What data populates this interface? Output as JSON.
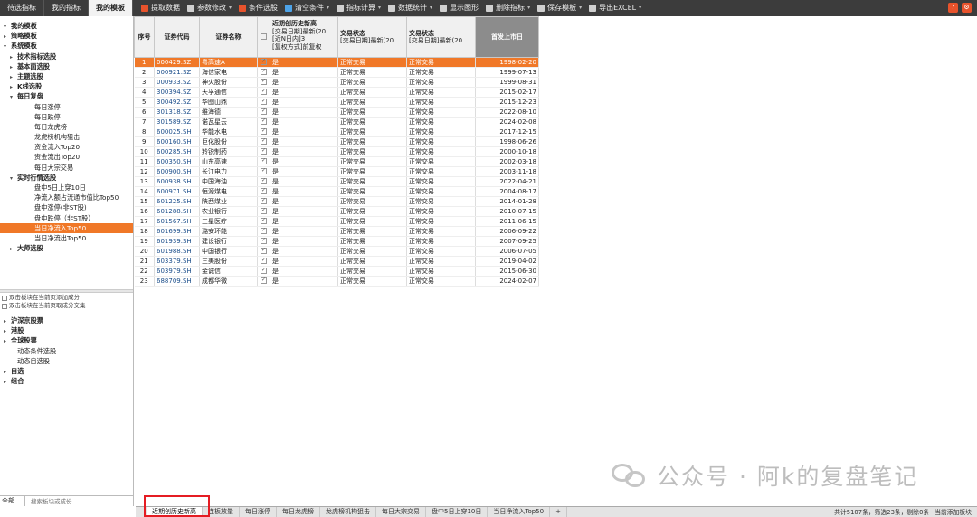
{
  "left_tabs": [
    "待选指标",
    "我的指标",
    "我的模板"
  ],
  "active_left_tab": 2,
  "toolbar": [
    {
      "label": "提取数据",
      "icon": "extract-icon",
      "color": "#e8532c",
      "caret": false
    },
    {
      "label": "参数修改",
      "icon": "pencil-icon",
      "color": "#cfcfcf",
      "caret": true
    },
    {
      "label": "条件选股",
      "icon": "filter-icon",
      "color": "#e8532c",
      "caret": false
    },
    {
      "label": "清空条件",
      "icon": "clear-icon",
      "color": "#4da3e8",
      "caret": true
    },
    {
      "label": "指标计算",
      "icon": "calc-icon",
      "color": "#cfcfcf",
      "caret": true
    },
    {
      "label": "数据统计",
      "icon": "stats-icon",
      "color": "#cfcfcf",
      "caret": true
    },
    {
      "label": "显示图形",
      "icon": "chart-icon",
      "color": "#cfcfcf",
      "caret": false
    },
    {
      "label": "删除指标",
      "icon": "delete-icon",
      "color": "#cfcfcf",
      "caret": true
    },
    {
      "label": "保存模板",
      "icon": "save-icon",
      "color": "#cfcfcf",
      "caret": true
    },
    {
      "label": "导出EXCEL",
      "icon": "excel-icon",
      "color": "#cfcfcf",
      "caret": true
    }
  ],
  "top_right_icons": [
    {
      "name": "help-icon",
      "glyph": "?",
      "color": "#e8532c"
    },
    {
      "name": "settings-icon",
      "glyph": "⚙",
      "color": "#e8532c"
    }
  ],
  "tree": [
    {
      "label": "我的模板",
      "level": 0,
      "arrow": "▾",
      "bold": true
    },
    {
      "label": "策略模板",
      "level": 0,
      "arrow": "▸",
      "bold": true
    },
    {
      "label": "系统模板",
      "level": 0,
      "arrow": "▾",
      "bold": true
    },
    {
      "label": "技术指标选股",
      "level": 1,
      "arrow": "▸",
      "bold": true
    },
    {
      "label": "基本面选股",
      "level": 1,
      "arrow": "▸",
      "bold": true
    },
    {
      "label": "主题选股",
      "level": 1,
      "arrow": "▸",
      "bold": true
    },
    {
      "label": "K线选股",
      "level": 1,
      "arrow": "▸",
      "bold": true
    },
    {
      "label": "每日复盘",
      "level": 1,
      "arrow": "▾",
      "bold": true
    },
    {
      "label": "每日涨停",
      "level": 2,
      "arrow": "",
      "bold": false
    },
    {
      "label": "每日跌停",
      "level": 2,
      "arrow": "",
      "bold": false
    },
    {
      "label": "每日龙虎榜",
      "level": 2,
      "arrow": "",
      "bold": false
    },
    {
      "label": "龙虎榜机构狙击",
      "level": 2,
      "arrow": "",
      "bold": false
    },
    {
      "label": "资金流入Top20",
      "level": 2,
      "arrow": "",
      "bold": false
    },
    {
      "label": "资金流出Top20",
      "level": 2,
      "arrow": "",
      "bold": false
    },
    {
      "label": "每日大宗交易",
      "level": 2,
      "arrow": "",
      "bold": false
    },
    {
      "label": "实时行情选股",
      "level": 1,
      "arrow": "▾",
      "bold": true
    },
    {
      "label": "盘中5日上穿10日",
      "level": 2,
      "arrow": "",
      "bold": false
    },
    {
      "label": "净流入额占流通市值比Top50",
      "level": 2,
      "arrow": "",
      "bold": false
    },
    {
      "label": "盘中涨停(非ST股)",
      "level": 2,
      "arrow": "",
      "bold": false
    },
    {
      "label": "盘中跌停（非ST股）",
      "level": 2,
      "arrow": "",
      "bold": false
    },
    {
      "label": "当日净流入Top50",
      "level": 2,
      "arrow": "",
      "bold": false,
      "selected": true
    },
    {
      "label": "当日净流出Top50",
      "level": 2,
      "arrow": "",
      "bold": false
    },
    {
      "label": "大师选股",
      "level": 1,
      "arrow": "▸",
      "bold": true
    }
  ],
  "checkbox_options": [
    "双击板块在当前页添加成分",
    "双击板块在当前页取成分交集"
  ],
  "tree2": [
    {
      "label": "沪深京股票",
      "level": 0,
      "arrow": "▸",
      "bold": true
    },
    {
      "label": "港股",
      "level": 0,
      "arrow": "▸",
      "bold": true
    },
    {
      "label": "全球股票",
      "level": 0,
      "arrow": "▸",
      "bold": true
    },
    {
      "label": "动态条件选股",
      "level": 1,
      "arrow": "",
      "bold": false
    },
    {
      "label": "动态自选股",
      "level": 1,
      "arrow": "",
      "bold": false
    },
    {
      "label": "自选",
      "level": 0,
      "arrow": "▸",
      "bold": true
    },
    {
      "label": "组合",
      "level": 0,
      "arrow": "▸",
      "bold": true
    }
  ],
  "search": {
    "select": "全部",
    "placeholder": "搜索板块或成份"
  },
  "table": {
    "headers": {
      "seq": "序号",
      "code": "证券代码",
      "name": "证券名称",
      "flag_title": "近期创历史新高",
      "flag_lines": [
        "[交易日期]最新(20..",
        "[近N日内]3",
        "[复权方式]前复权"
      ],
      "status1_title": "交易状态",
      "status1_line": "[交易日期]最新(20..",
      "status2_title": "交易状态",
      "status2_line": "[交易日期]最新(20..",
      "ipo": "首发上市日"
    },
    "rows": [
      {
        "seq": "1",
        "code": "000429.SZ",
        "name": "粤高速A",
        "flag": "是",
        "s1": "正常交易",
        "s2": "正常交易",
        "ipo": "1998-02-20",
        "selected": true
      },
      {
        "seq": "2",
        "code": "000921.SZ",
        "name": "海信家电",
        "flag": "是",
        "s1": "正常交易",
        "s2": "正常交易",
        "ipo": "1999-07-13"
      },
      {
        "seq": "3",
        "code": "000933.SZ",
        "name": "神火股份",
        "flag": "是",
        "s1": "正常交易",
        "s2": "正常交易",
        "ipo": "1999-08-31"
      },
      {
        "seq": "4",
        "code": "300394.SZ",
        "name": "天孚通信",
        "flag": "是",
        "s1": "正常交易",
        "s2": "正常交易",
        "ipo": "2015-02-17"
      },
      {
        "seq": "5",
        "code": "300492.SZ",
        "name": "华图山鼎",
        "flag": "是",
        "s1": "正常交易",
        "s2": "正常交易",
        "ipo": "2015-12-23"
      },
      {
        "seq": "6",
        "code": "301318.SZ",
        "name": "维海德",
        "flag": "是",
        "s1": "正常交易",
        "s2": "正常交易",
        "ipo": "2022-08-10"
      },
      {
        "seq": "7",
        "code": "301589.SZ",
        "name": "诺瓦星云",
        "flag": "是",
        "s1": "正常交易",
        "s2": "正常交易",
        "ipo": "2024-02-08"
      },
      {
        "seq": "8",
        "code": "600025.SH",
        "name": "华能水电",
        "flag": "是",
        "s1": "正常交易",
        "s2": "正常交易",
        "ipo": "2017-12-15"
      },
      {
        "seq": "9",
        "code": "600160.SH",
        "name": "巨化股份",
        "flag": "是",
        "s1": "正常交易",
        "s2": "正常交易",
        "ipo": "1998-06-26"
      },
      {
        "seq": "10",
        "code": "600285.SH",
        "name": "羚锐制药",
        "flag": "是",
        "s1": "正常交易",
        "s2": "正常交易",
        "ipo": "2000-10-18"
      },
      {
        "seq": "11",
        "code": "600350.SH",
        "name": "山东高速",
        "flag": "是",
        "s1": "正常交易",
        "s2": "正常交易",
        "ipo": "2002-03-18"
      },
      {
        "seq": "12",
        "code": "600900.SH",
        "name": "长江电力",
        "flag": "是",
        "s1": "正常交易",
        "s2": "正常交易",
        "ipo": "2003-11-18"
      },
      {
        "seq": "13",
        "code": "600938.SH",
        "name": "中国海油",
        "flag": "是",
        "s1": "正常交易",
        "s2": "正常交易",
        "ipo": "2022-04-21"
      },
      {
        "seq": "14",
        "code": "600971.SH",
        "name": "恒源煤电",
        "flag": "是",
        "s1": "正常交易",
        "s2": "正常交易",
        "ipo": "2004-08-17"
      },
      {
        "seq": "15",
        "code": "601225.SH",
        "name": "陕西煤业",
        "flag": "是",
        "s1": "正常交易",
        "s2": "正常交易",
        "ipo": "2014-01-28"
      },
      {
        "seq": "16",
        "code": "601288.SH",
        "name": "农业银行",
        "flag": "是",
        "s1": "正常交易",
        "s2": "正常交易",
        "ipo": "2010-07-15"
      },
      {
        "seq": "17",
        "code": "601567.SH",
        "name": "三星医疗",
        "flag": "是",
        "s1": "正常交易",
        "s2": "正常交易",
        "ipo": "2011-06-15"
      },
      {
        "seq": "18",
        "code": "601699.SH",
        "name": "潞安环能",
        "flag": "是",
        "s1": "正常交易",
        "s2": "正常交易",
        "ipo": "2006-09-22"
      },
      {
        "seq": "19",
        "code": "601939.SH",
        "name": "建设银行",
        "flag": "是",
        "s1": "正常交易",
        "s2": "正常交易",
        "ipo": "2007-09-25"
      },
      {
        "seq": "20",
        "code": "601988.SH",
        "name": "中国银行",
        "flag": "是",
        "s1": "正常交易",
        "s2": "正常交易",
        "ipo": "2006-07-05"
      },
      {
        "seq": "21",
        "code": "603379.SH",
        "name": "三美股份",
        "flag": "是",
        "s1": "正常交易",
        "s2": "正常交易",
        "ipo": "2019-04-02"
      },
      {
        "seq": "22",
        "code": "603979.SH",
        "name": "金诚信",
        "flag": "是",
        "s1": "正常交易",
        "s2": "正常交易",
        "ipo": "2015-06-30"
      },
      {
        "seq": "23",
        "code": "688709.SH",
        "name": "成都华微",
        "flag": "是",
        "s1": "正常交易",
        "s2": "正常交易",
        "ipo": "2024-02-07"
      }
    ]
  },
  "bottom_tabs": [
    "近期创历史新高",
    "连板放量",
    "每日涨停",
    "每日龙虎榜",
    "龙虎榜机构狙击",
    "每日大宗交易",
    "盘中5日上穿10日",
    "当日净流入Top50",
    "+"
  ],
  "active_bottom_tab": 0,
  "status": [
    "共计5107条，筛选23条，剔除0条",
    "当前添加板块"
  ],
  "watermark": "公众号 · 阿k的复盘笔记",
  "colors": {
    "accent": "#f07828",
    "highlight_box": "#e51c23"
  }
}
